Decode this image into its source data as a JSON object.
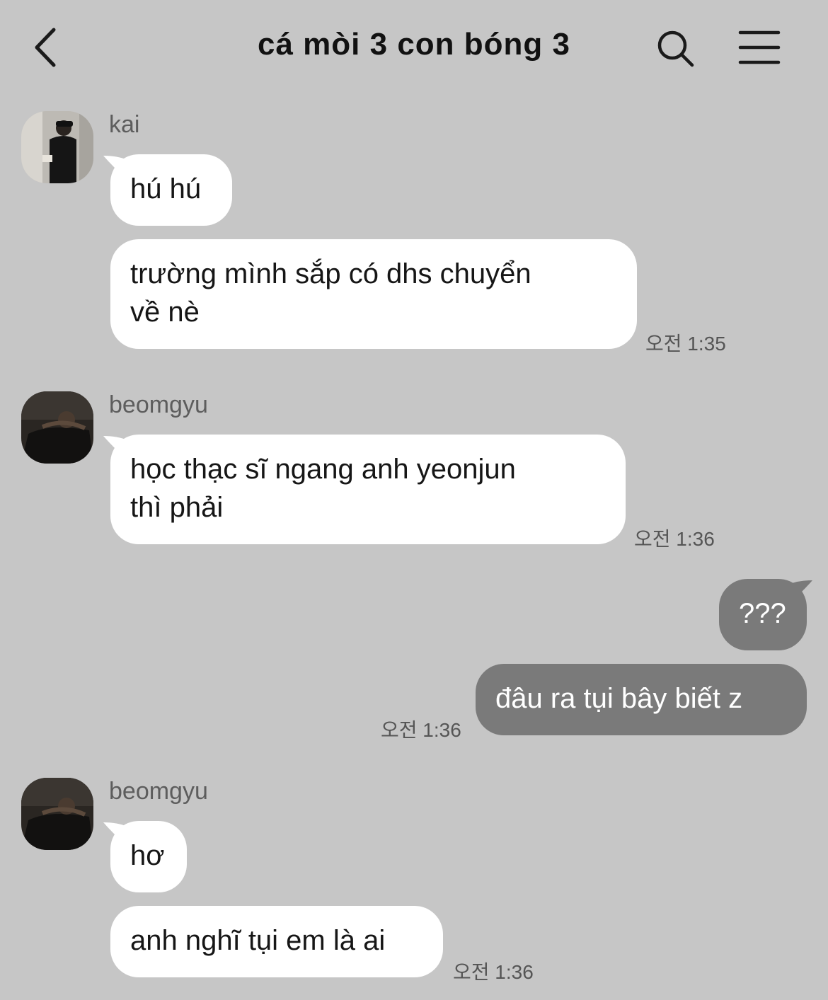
{
  "header": {
    "title": "cá mòi 3 con bóng 3",
    "back_icon": "chevron-left-icon",
    "search_icon": "search-icon",
    "menu_icon": "hamburger-menu-icon"
  },
  "colors": {
    "background": "#c6c6c6",
    "incoming_bubble": "#ffffff",
    "outgoing_bubble": "#7a7a7a"
  },
  "messages": [
    {
      "sender": "kai",
      "direction": "incoming",
      "bubbles": [
        "hú hú",
        "trường mình sắp có dhs chuyển\nvề nè"
      ],
      "time": "오전 1:35"
    },
    {
      "sender": "beomgyu",
      "direction": "incoming",
      "bubbles": [
        "học thạc sĩ ngang anh yeonjun\nthì phải"
      ],
      "time": "오전 1:36"
    },
    {
      "sender": "",
      "direction": "outgoing",
      "bubbles": [
        "???",
        "đâu ra tụi bây biết z"
      ],
      "time": "오전 1:36"
    },
    {
      "sender": "beomgyu",
      "direction": "incoming",
      "bubbles": [
        "hơ",
        "anh nghĩ tụi em là ai"
      ],
      "time": "오전 1:36"
    }
  ]
}
